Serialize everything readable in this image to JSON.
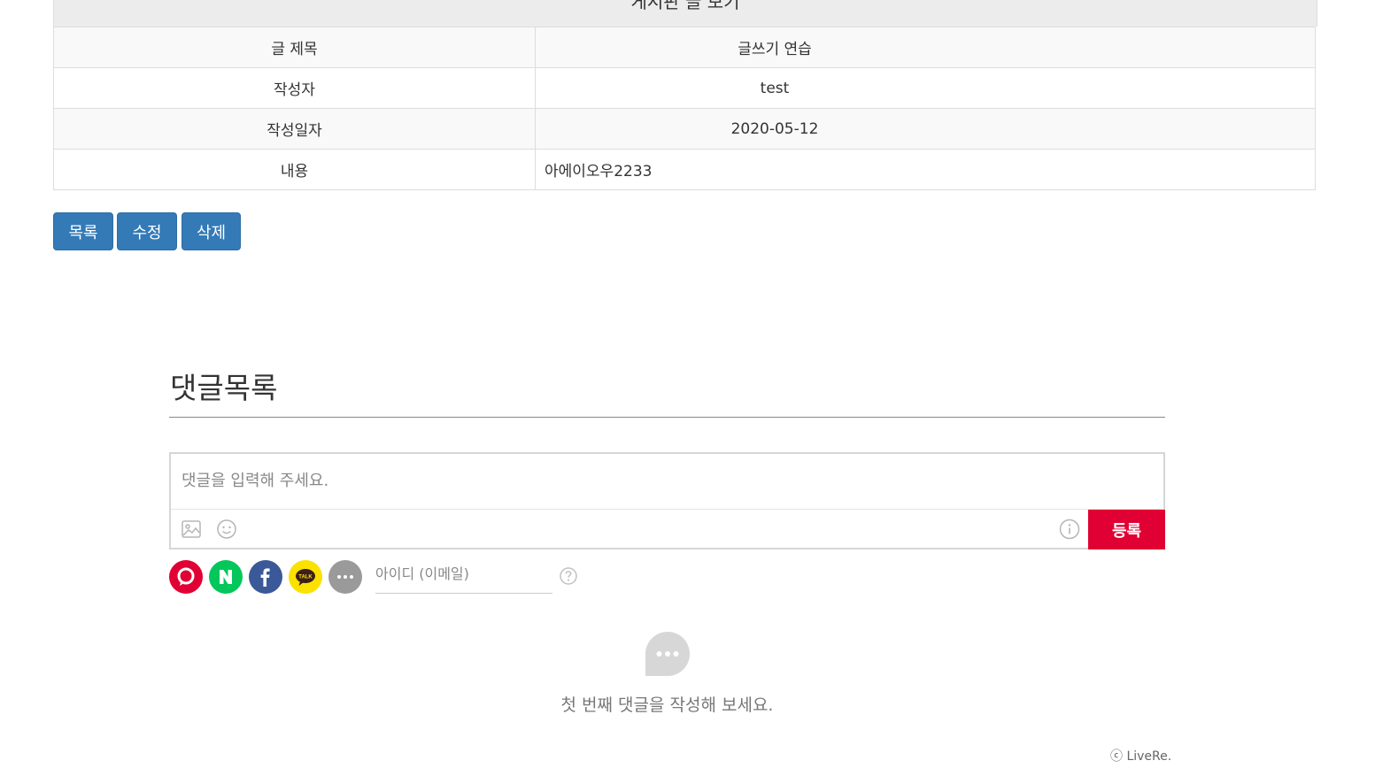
{
  "page": {
    "partial_title": "게시판 글 보기"
  },
  "post": {
    "rows": [
      {
        "label": "글 제목",
        "value": "글쓰기 연습"
      },
      {
        "label": "작성자",
        "value": "test"
      },
      {
        "label": "작성일자",
        "value": "2020-05-12"
      },
      {
        "label": "내용",
        "value": "아에이오우2233"
      }
    ]
  },
  "buttons": {
    "list": "목록",
    "edit": "수정",
    "delete": "삭제"
  },
  "comments": {
    "title": "댓글목록",
    "placeholder": "댓글을 입력해 주세요.",
    "submit": "등록",
    "id_placeholder": "아이디 (이메일)",
    "empty": "첫 번째 댓글을 작성해 보세요.",
    "credit": "ⓒ LiveRe.",
    "sns": [
      "livere-icon",
      "naver-icon",
      "facebook-icon",
      "kakao-talk-icon",
      "more-icon"
    ]
  },
  "colors": {
    "primary": "#337ab7",
    "submit": "#e10033",
    "naver": "#03c75a",
    "facebook": "#3b5998",
    "kakao": "#fae100"
  }
}
